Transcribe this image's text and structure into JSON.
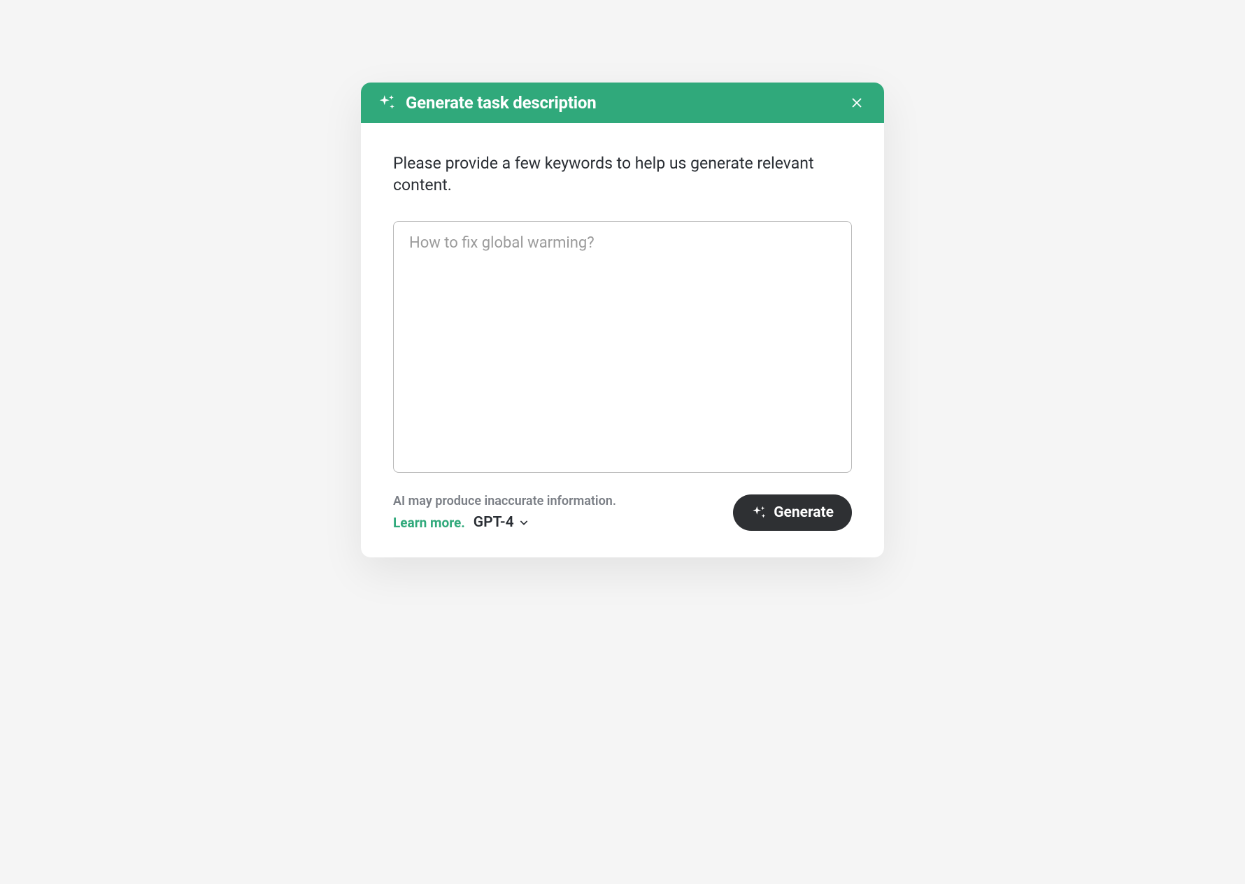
{
  "modal": {
    "title": "Generate task description",
    "instructions": "Please provide a few keywords to help us generate relevant content.",
    "input": {
      "placeholder": "How to fix global warming?"
    },
    "footer": {
      "disclaimer": "AI may produce inaccurate information.",
      "learn_more": "Learn more.",
      "model": "GPT-4",
      "generate_label": "Generate"
    }
  },
  "icons": {
    "header_sparkle": "sparkle-icon",
    "close": "close-icon",
    "chevron": "chevron-down-icon",
    "generate_sparkle": "sparkle-icon"
  }
}
